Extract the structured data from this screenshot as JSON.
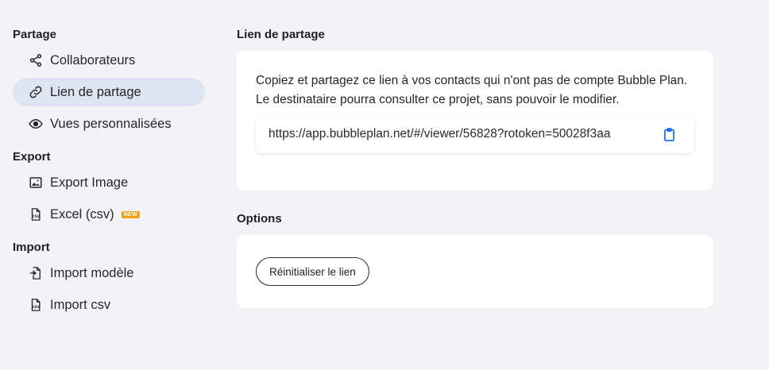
{
  "sidebar": {
    "sections": [
      {
        "title": "Partage",
        "items": [
          {
            "label": "Collaborateurs",
            "icon": "share-icon",
            "active": false
          },
          {
            "label": "Lien de partage",
            "icon": "link-icon",
            "active": true
          },
          {
            "label": "Vues personnalisées",
            "icon": "eye-icon",
            "active": false
          }
        ]
      },
      {
        "title": "Export",
        "items": [
          {
            "label": "Export Image",
            "icon": "image-icon",
            "active": false
          },
          {
            "label": "Excel (csv)",
            "icon": "csv-file-icon",
            "active": false,
            "badge": "NEW"
          }
        ]
      },
      {
        "title": "Import",
        "items": [
          {
            "label": "Import modèle",
            "icon": "file-import-icon",
            "active": false
          },
          {
            "label": "Import csv",
            "icon": "csv-file-icon",
            "active": false
          }
        ]
      }
    ]
  },
  "main": {
    "share": {
      "title": "Lien de partage",
      "description": "Copiez et partagez ce lien à vos contacts qui n'ont pas de compte Bubble Plan. Le destinataire pourra consulter ce projet, sans pouvoir le modifier.",
      "link": "https://app.bubbleplan.net/#/viewer/56828?rotoken=50028f3aa",
      "copy_icon": "clipboard-icon"
    },
    "options": {
      "title": "Options",
      "reset_label": "Réinitialiser le lien"
    }
  },
  "colors": {
    "background": "#f3f3f5",
    "active_item": "#dde4f2",
    "copy_icon": "#1a73e8",
    "badge": "#f0a21a"
  }
}
